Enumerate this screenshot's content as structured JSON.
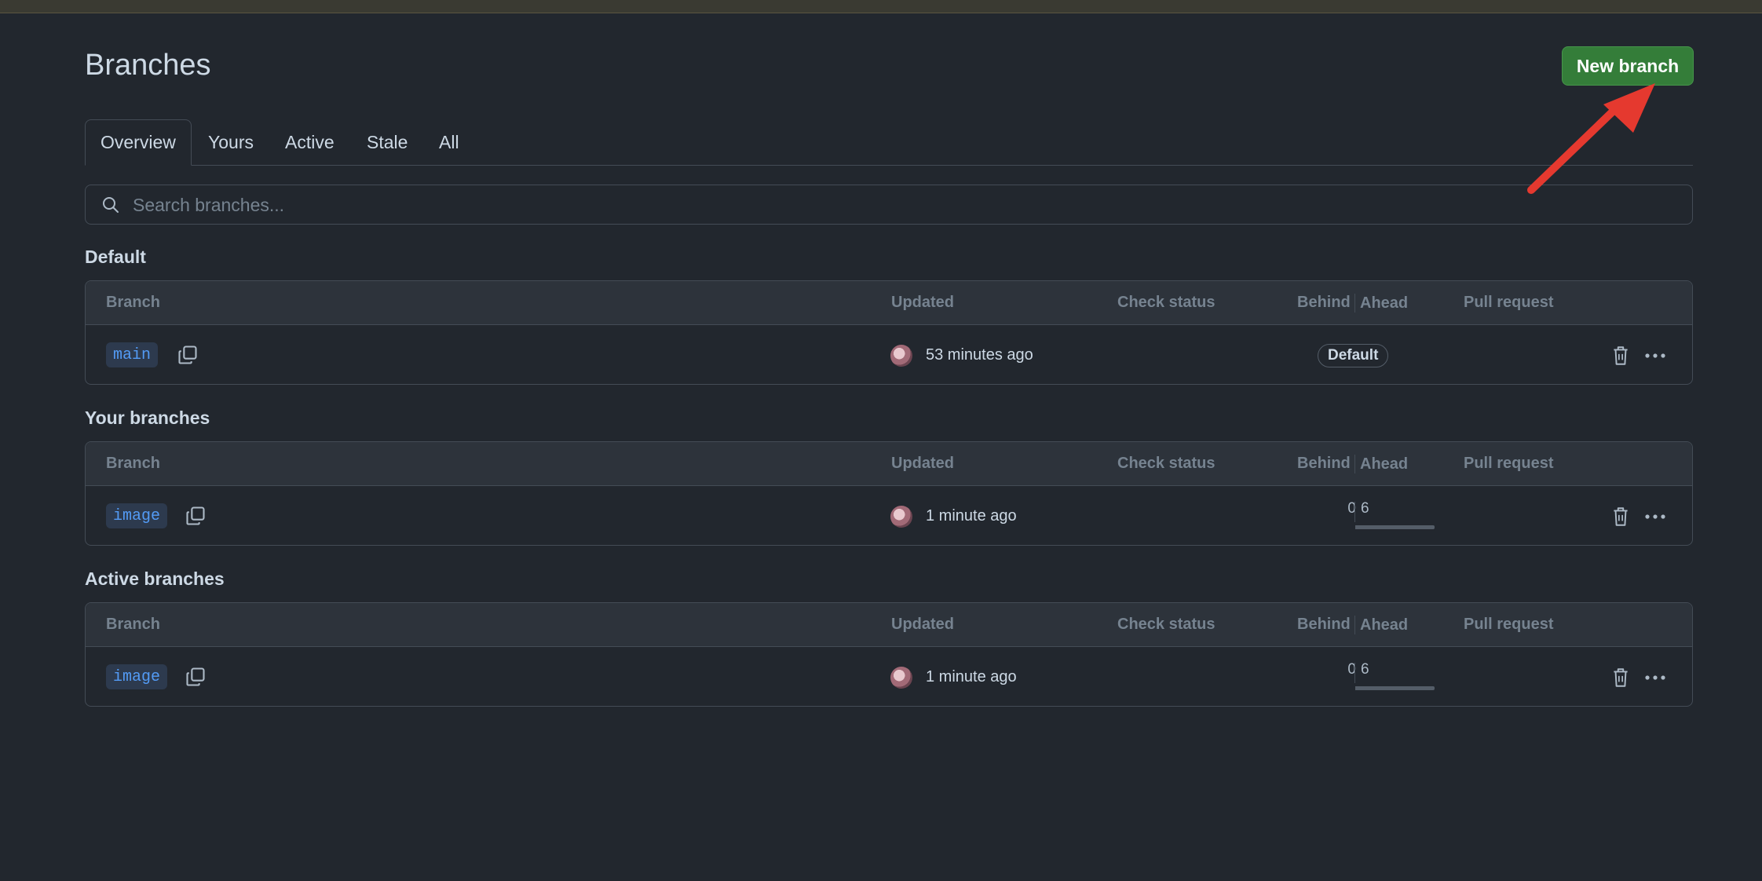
{
  "page": {
    "title": "Branches",
    "new_branch_label": "New branch"
  },
  "tabs": [
    {
      "label": "Overview",
      "selected": true
    },
    {
      "label": "Yours"
    },
    {
      "label": "Active"
    },
    {
      "label": "Stale"
    },
    {
      "label": "All"
    }
  ],
  "search": {
    "placeholder": "Search branches...",
    "value": ""
  },
  "columns": {
    "branch": "Branch",
    "updated": "Updated",
    "check_status": "Check status",
    "behind": "Behind",
    "ahead": "Ahead",
    "pull_request": "Pull request"
  },
  "sections": [
    {
      "title": "Default",
      "rows": [
        {
          "branch": "main",
          "updated": "53 minutes ago",
          "badge": "Default"
        }
      ]
    },
    {
      "title": "Your branches",
      "rows": [
        {
          "branch": "image",
          "updated": "1 minute ago",
          "behind": "0",
          "ahead": "6"
        }
      ]
    },
    {
      "title": "Active branches",
      "rows": [
        {
          "branch": "image",
          "updated": "1 minute ago",
          "behind": "0",
          "ahead": "6"
        }
      ]
    }
  ],
  "colors": {
    "background": "#22272e",
    "primary_button": "#347d39",
    "annotation_arrow": "#e5392f",
    "link": "#539bf5"
  },
  "icons": [
    "search-icon",
    "copy-icon",
    "trash-icon",
    "kebab-horizontal-icon",
    "avatar"
  ]
}
